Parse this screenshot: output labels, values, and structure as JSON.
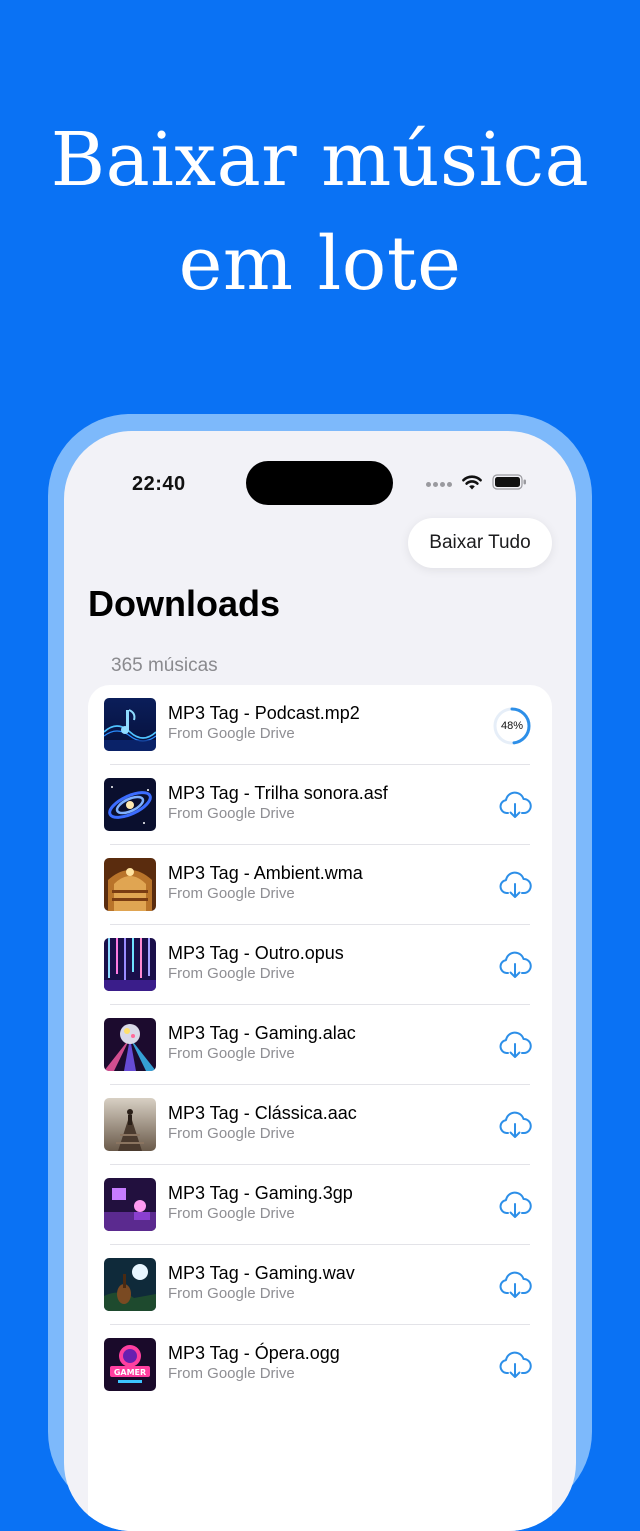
{
  "headline": {
    "line1": "Baixar música",
    "line2": "em lote"
  },
  "status_bar": {
    "time": "22:40",
    "icons": [
      "signal-dots-icon",
      "wifi-icon",
      "battery-icon"
    ]
  },
  "toolbar": {
    "download_all_label": "Baixar Tudo"
  },
  "page": {
    "title": "Downloads",
    "count_label": "365 músicas"
  },
  "colors": {
    "background": "#0A72F4",
    "frame": "#7DB9FB",
    "screen": "#F2F2F7",
    "accent": "#2D8FE8"
  },
  "downloads": [
    {
      "title": "MP3 Tag - Podcast.mp2",
      "source": "From Google Drive",
      "status": "downloading",
      "progress_label": "48%",
      "progress": 0.48,
      "thumb": "blue-sound-wave"
    },
    {
      "title": "MP3 Tag - Trilha sonora.asf",
      "source": "From Google Drive",
      "status": "download",
      "icon": "cloud-download-icon",
      "thumb": "galaxy"
    },
    {
      "title": "MP3 Tag - Ambient.wma",
      "source": "From Google Drive",
      "status": "download",
      "icon": "cloud-download-icon",
      "thumb": "opera-house"
    },
    {
      "title": "MP3 Tag - Outro.opus",
      "source": "From Google Drive",
      "status": "download",
      "icon": "cloud-download-icon",
      "thumb": "neon-lights"
    },
    {
      "title": "MP3 Tag - Gaming.alac",
      "source": "From Google Drive",
      "status": "download",
      "icon": "cloud-download-icon",
      "thumb": "disco-ball"
    },
    {
      "title": "MP3 Tag - Clássica.aac",
      "source": "From Google Drive",
      "status": "download",
      "icon": "cloud-download-icon",
      "thumb": "railway-walker"
    },
    {
      "title": "MP3 Tag - Gaming.3gp",
      "source": "From Google Drive",
      "status": "download",
      "icon": "cloud-download-icon",
      "thumb": "purple-room"
    },
    {
      "title": "MP3 Tag - Gaming.wav",
      "source": "From Google Drive",
      "status": "download",
      "icon": "cloud-download-icon",
      "thumb": "moon-guitar"
    },
    {
      "title": "MP3 Tag - Ópera.ogg",
      "source": "From Google Drive",
      "status": "download",
      "icon": "cloud-download-icon",
      "thumb": "gamer-logo",
      "thumb_text": "GAMER"
    }
  ]
}
